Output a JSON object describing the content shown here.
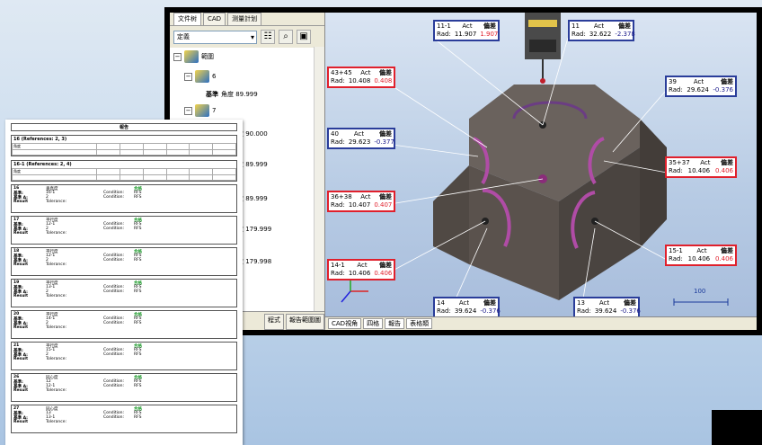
{
  "app": {
    "tabs": [
      "文件树",
      "CAD",
      "测量計划"
    ],
    "combo_value": "定義",
    "tree": {
      "root_label": "範圍",
      "nodes": [
        {
          "label": "6",
          "sub": "基準"
        },
        {
          "label": "7"
        }
      ],
      "angles": [
        "角度 89.999",
        "角度 90.000",
        "角度 89.999",
        "角度 89.999",
        "角度 179.999",
        "角度 179.998"
      ],
      "minus_one": "-1"
    },
    "bottom_tabs": [
      "程式",
      "報告範圍圖"
    ],
    "viewport_tabs": [
      "CAD視角",
      "四格",
      "報告",
      "表格類"
    ],
    "scale_value": "100"
  },
  "labels": [
    {
      "id": "11-1",
      "act": "Act",
      "dev": "偏差",
      "rad": "Rad:",
      "v1": "11.907",
      "v2": "1.907",
      "border": "blue",
      "devcolor": "pos"
    },
    {
      "id": "11",
      "act": "Act",
      "dev": "偏差",
      "rad": "Rad:",
      "v1": "32.622",
      "v2": "-2.378",
      "border": "blue",
      "devcolor": "neg"
    },
    {
      "id": "43+45",
      "act": "Act",
      "dev": "偏差",
      "rad": "Rad:",
      "v1": "10.408",
      "v2": "0.408",
      "border": "red",
      "devcolor": "pos"
    },
    {
      "id": "39",
      "act": "Act",
      "dev": "偏差",
      "rad": "Rad:",
      "v1": "29.624",
      "v2": "-0.376",
      "border": "blue",
      "devcolor": "neg"
    },
    {
      "id": "40",
      "act": "Act",
      "dev": "偏差",
      "rad": "Rad:",
      "v1": "29.623",
      "v2": "-0.377",
      "border": "blue",
      "devcolor": "neg"
    },
    {
      "id": "35+37",
      "act": "Act",
      "dev": "偏差",
      "rad": "Rad:",
      "v1": "10.406",
      "v2": "0.406",
      "border": "red",
      "devcolor": "pos"
    },
    {
      "id": "36+38",
      "act": "Act",
      "dev": "偏差",
      "rad": "Rad:",
      "v1": "10.407",
      "v2": "0.407",
      "border": "red",
      "devcolor": "pos"
    },
    {
      "id": "15-1",
      "act": "Act",
      "dev": "偏差",
      "rad": "Rad:",
      "v1": "10.406",
      "v2": "0.406",
      "border": "red",
      "devcolor": "pos"
    },
    {
      "id": "14-1",
      "act": "Act",
      "dev": "偏差",
      "rad": "Rad:",
      "v1": "10.406",
      "v2": "0.406",
      "border": "red",
      "devcolor": "pos"
    },
    {
      "id": "14",
      "act": "Act",
      "dev": "偏差",
      "rad": "Rad:",
      "v1": "39.624",
      "v2": "-0.376",
      "border": "blue",
      "devcolor": "neg"
    },
    {
      "id": "13",
      "act": "Act",
      "dev": "偏差",
      "rad": "Rad:",
      "v1": "39.624",
      "v2": "-0.376",
      "border": "blue",
      "devcolor": "neg"
    }
  ],
  "report": {
    "title": "報告",
    "refs": [
      {
        "title": "16 (References: 2, 3)",
        "name": "角度"
      },
      {
        "title": "16-1 (References: 2, 4)",
        "name": "角度"
      }
    ],
    "features": [
      {
        "num": "16",
        "type": "垂直度",
        "a": "基準:",
        "a_val": "16-1",
        "b": "基準 A:",
        "b_val": "2",
        "res": "Result",
        "tol": "Tolerance:",
        "cond": "Condition:",
        "cond_val": "RFS",
        "status": "合格"
      },
      {
        "num": "17",
        "type": "平行度",
        "a": "基準:",
        "a_val": "12-1",
        "b": "基準 A:",
        "b_val": "2",
        "res": "Result",
        "tol": "Tolerance:",
        "cond": "Condition:",
        "cond_val": "RFS",
        "status": "合格"
      },
      {
        "num": "18",
        "type": "平行度",
        "a": "基準:",
        "a_val": "12-1",
        "b": "基準 A:",
        "b_val": "2",
        "res": "Result",
        "tol": "Tolerance:",
        "cond": "Condition:",
        "cond_val": "RFS",
        "status": "合格"
      },
      {
        "num": "19",
        "type": "平行度",
        "a": "基準:",
        "a_val": "13-1",
        "b": "基準 A:",
        "b_val": "2",
        "res": "Result",
        "tol": "Tolerance:",
        "cond": "Condition:",
        "cond_val": "RFS",
        "status": "合格"
      },
      {
        "num": "20",
        "type": "平行度",
        "a": "基準:",
        "a_val": "14-1",
        "b": "基準 A:",
        "b_val": "2",
        "res": "Result",
        "tol": "Tolerance:",
        "cond": "Condition:",
        "cond_val": "RFS",
        "status": "合格"
      },
      {
        "num": "21",
        "type": "平行度",
        "a": "基準:",
        "a_val": "15-1",
        "b": "基準 A:",
        "b_val": "2",
        "res": "Result",
        "tol": "Tolerance:",
        "cond": "Condition:",
        "cond_val": "RFS",
        "status": "合格"
      },
      {
        "num": "26",
        "type": "同心度",
        "a": "基準:",
        "a_val": "12",
        "b": "基準 A:",
        "b_val": "12-1",
        "res": "Result",
        "tol": "Tolerance:",
        "cond": "Condition:",
        "cond_val": "RFS",
        "status": "合格"
      },
      {
        "num": "27",
        "type": "同心度",
        "a": "基準:",
        "a_val": "13",
        "b": "基準 A:",
        "b_val": "13-1",
        "res": "Result",
        "tol": "Tolerance:",
        "cond": "Condition:",
        "cond_val": "RFS",
        "status": "合格"
      }
    ]
  }
}
